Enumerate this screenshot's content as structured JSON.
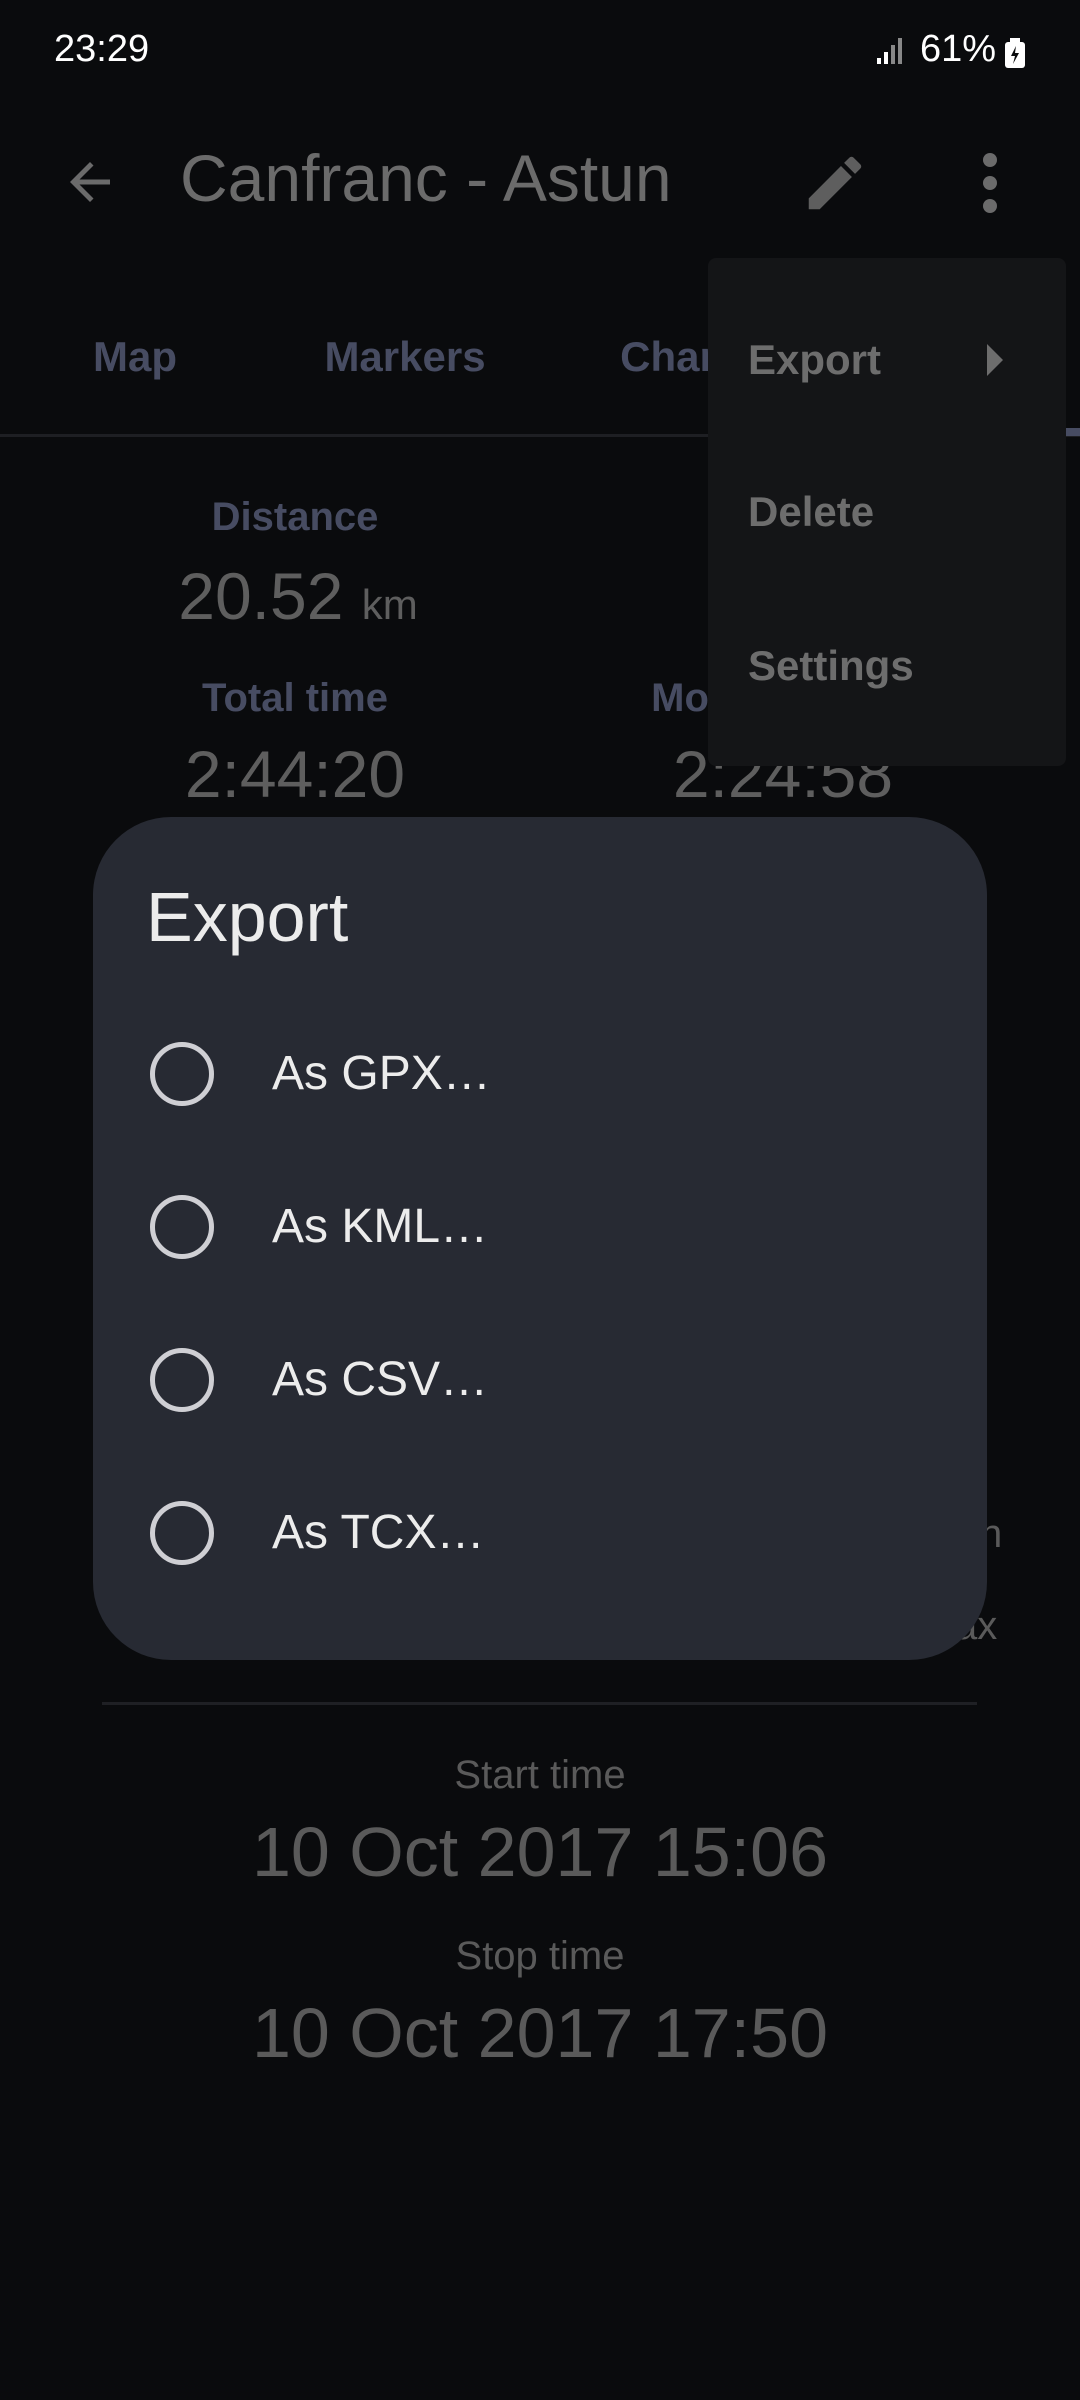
{
  "status_bar": {
    "time": "23:29",
    "battery": "61%",
    "icons": [
      "signal-icon",
      "battery-charging-icon"
    ]
  },
  "toolbar": {
    "title": "Canfranc - Astun",
    "icons": [
      "back-arrow-icon",
      "pencil-icon",
      "more-vert-icon"
    ]
  },
  "tabs": [
    {
      "label": "Map"
    },
    {
      "label": "Markers"
    },
    {
      "label": "Char"
    }
  ],
  "stats": {
    "distance": {
      "label": "Distance",
      "value": "20.52",
      "unit": "km"
    },
    "total_time": {
      "label": "Total time",
      "value": "2:44:20"
    },
    "moving_time": {
      "label": "Mo",
      "value": "2:24:58"
    },
    "partial_right_1": "n",
    "partial_right_2": "ax"
  },
  "times": {
    "start": {
      "label": "Start time",
      "value": "10 Oct 2017 15:06"
    },
    "stop": {
      "label": "Stop time",
      "value": "10 Oct 2017 17:50"
    }
  },
  "overflow_menu": {
    "items": [
      {
        "label": "Export",
        "has_submenu": true
      },
      {
        "label": "Delete"
      },
      {
        "label": "Settings"
      }
    ]
  },
  "dialog": {
    "title": "Export",
    "options": [
      {
        "label": "As GPX…",
        "selected": false
      },
      {
        "label": "As KML…",
        "selected": false
      },
      {
        "label": "As CSV…",
        "selected": false
      },
      {
        "label": "As TCX…",
        "selected": false
      }
    ]
  }
}
